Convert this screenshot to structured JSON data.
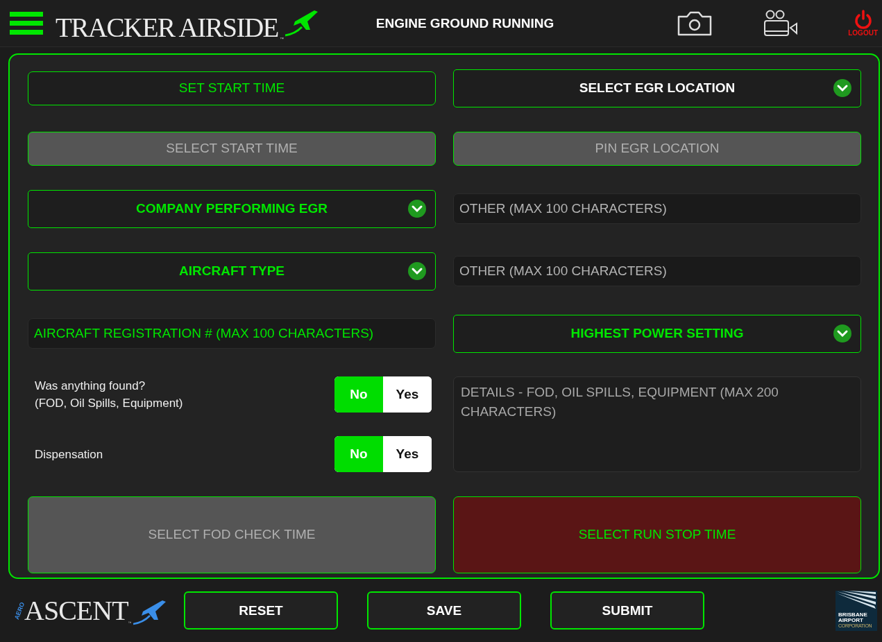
{
  "header": {
    "app_name": "TRACKER AIRSIDE",
    "app_tm": "™",
    "title": "ENGINE GROUND RUNNING",
    "logout_label": "LOGOUT"
  },
  "form": {
    "left": [
      {
        "kind": "button",
        "label": "SET START TIME",
        "disabled": false
      },
      {
        "kind": "button",
        "label": "SELECT START TIME",
        "disabled": true
      },
      {
        "kind": "dropdown",
        "label": "COMPANY PERFORMING EGR",
        "color": "#00e600"
      },
      {
        "kind": "dropdown",
        "label": "AIRCRAFT TYPE",
        "color": "#00e600"
      },
      {
        "kind": "input",
        "placeholder": "AIRCRAFT REGISTRATION # (MAX 100 CHARACTERS)",
        "color": "#00e600"
      },
      {
        "kind": "toggles",
        "items": [
          {
            "label_lines": [
              "Was anything found?",
              "(FOD, Oil Spills, Equipment)"
            ],
            "options": [
              {
                "label": "No",
                "selected": true
              },
              {
                "label": "Yes",
                "selected": false
              }
            ]
          },
          {
            "label_lines": [
              "Dispensation"
            ],
            "options": [
              {
                "label": "No",
                "selected": true
              },
              {
                "label": "Yes",
                "selected": false
              }
            ]
          }
        ]
      },
      {
        "kind": "big-button",
        "label": "SELECT FOD CHECK TIME",
        "disabled": true
      }
    ],
    "right": [
      {
        "kind": "dropdown",
        "label": "SELECT EGR LOCATION",
        "color": "#ffffff"
      },
      {
        "kind": "button",
        "label": "PIN EGR LOCATION",
        "disabled": true
      },
      {
        "kind": "input",
        "placeholder": "OTHER (MAX 100 CHARACTERS)",
        "color": "#b4b4b4"
      },
      {
        "kind": "input",
        "placeholder": "OTHER (MAX 100 CHARACTERS)",
        "color": "#b4b4b4"
      },
      {
        "kind": "dropdown",
        "label": "HIGHEST POWER SETTING",
        "color": "#00e600"
      },
      {
        "kind": "textarea",
        "placeholder": "DETAILS - FOD, OIL SPILLS, EQUIPMENT (MAX 200 CHARACTERS)",
        "color": "#a8a8a8"
      },
      {
        "kind": "big-button",
        "label": "SELECT RUN STOP TIME",
        "disabled": false
      }
    ]
  },
  "footer": {
    "ascent_prefix": "AERO",
    "ascent_name": "ASCENT",
    "ascent_tm": "™",
    "buttons": [
      "RESET",
      "SAVE",
      "SUBMIT"
    ],
    "partner_lines": [
      "BRISBANE",
      "AIRPORT",
      "CORPORATION"
    ]
  }
}
